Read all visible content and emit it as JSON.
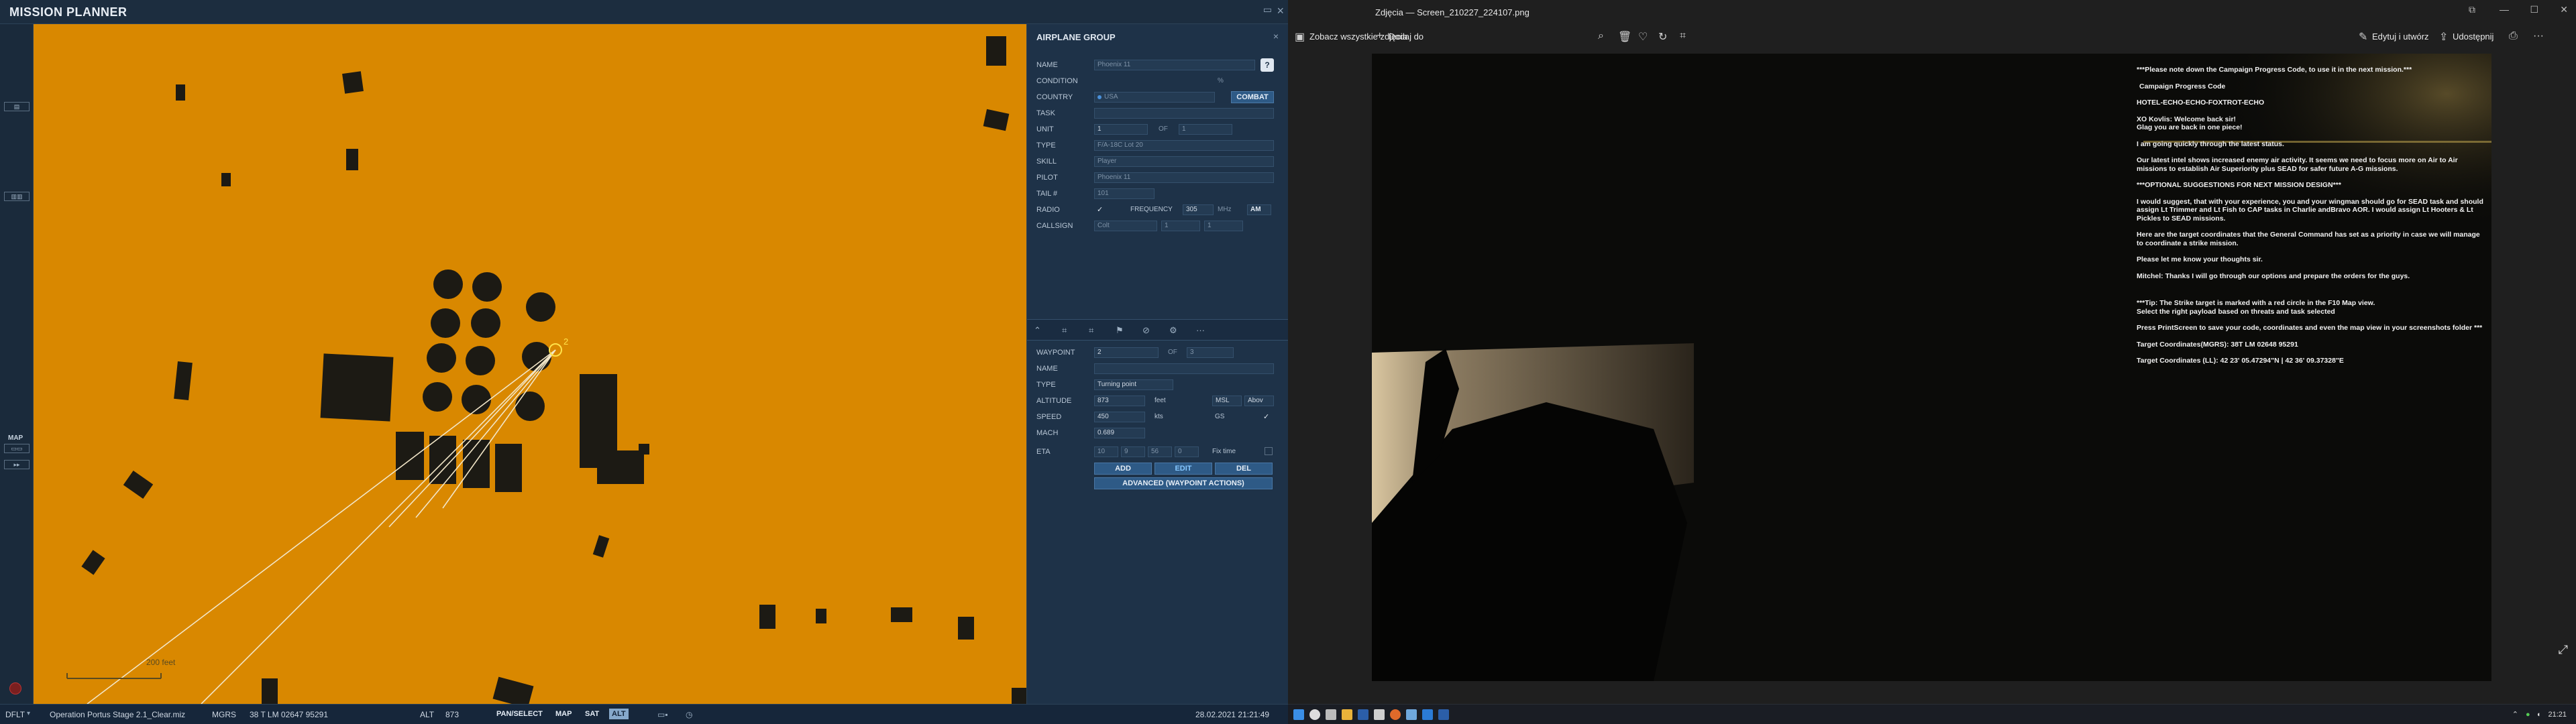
{
  "mission_planner": {
    "title": "MISSION PLANNER",
    "left_toolbar": {
      "map_label": "MAP"
    },
    "map": {
      "waypoint_label": "2",
      "scale_label": "200 feet"
    },
    "panel": {
      "group_title": "AIRPLANE GROUP",
      "help_label": "?",
      "fields": {
        "name_label": "NAME",
        "name_value": "Phoenix 11",
        "condition_label": "CONDITION",
        "condition_value": "%",
        "country_label": "COUNTRY",
        "country_value": "USA",
        "combat_label": "COMBAT",
        "task_label": "TASK",
        "unit_label": "UNIT",
        "unit_value": "1",
        "of_label": "OF",
        "unit_of_value": "1",
        "type_label": "TYPE",
        "type_value": "F/A-18C Lot 20",
        "skill_label": "SKILL",
        "skill_value": "Player",
        "pilot_label": "PILOT",
        "pilot_value": "Phoenix 11",
        "tail_label": "TAIL #",
        "tail_value": "101",
        "radio_label": "RADIO",
        "frequency_label": "FREQUENCY",
        "frequency_value": "305",
        "mhz_label": "MHz",
        "am_label": "AM",
        "callsign_label": "CALLSIGN",
        "callsign_value": "Colt",
        "callsign_n1": "1",
        "callsign_n2": "1"
      },
      "waypoint": {
        "waypoint_label": "WAYPOINT",
        "waypoint_value": "2",
        "of_label": "OF",
        "of_value": "3",
        "name_label": "NAME",
        "type_label": "TYPE",
        "type_value": "Turning point",
        "altitude_label": "ALTITUDE",
        "altitude_value": "873",
        "altitude_unit": "feet",
        "alt_ref": "MSL",
        "alt_ref2": "Abov",
        "speed_label": "SPEED",
        "speed_value": "450",
        "speed_unit": "kts",
        "gs_label": "GS",
        "mach_label": "MACH",
        "mach_value": "0.689",
        "eta_label": "ETA",
        "eta_h": "10",
        "eta_m": "9",
        "eta_s": "56",
        "eta_f": "0",
        "fix_time_label": "Fix time"
      },
      "buttons": {
        "add": "ADD",
        "edit": "EDIT",
        "del": "DEL",
        "advanced": "ADVANCED (WAYPOINT ACTIONS)"
      }
    },
    "status_bar": {
      "profile": "DFLT",
      "mission_file": "Operation Portus Stage 2.1_Clear.miz",
      "coord_system": "MGRS",
      "coords": "38 T LM 02647 95291",
      "alt_label": "ALT",
      "alt_value": "873",
      "pan_select": "PAN/SELECT",
      "map": "MAP",
      "sat": "SAT",
      "alt_btn": "ALT",
      "datetime": "28.02.2021 21:21:49"
    }
  },
  "photos": {
    "window_title": "Zdjęcia — Screen_210227_224107.png",
    "toolbar": {
      "see_all": "Zobacz wszystkie zdjęcia",
      "add_to": "Dodaj do",
      "edit_create": "Edytuj i utwórz",
      "share": "Udostępnij"
    },
    "briefing": [
      "***Please note down the Campaign Progress Code, to use it in the next mission.***",
      "Campaign Progress Code",
      "HOTEL-ECHO-ECHO-FOXTROT-ECHO",
      "XO Kovlis: Welcome back sir!",
      "Glag you are back in one piece!",
      "I am going quickly through the latest status.",
      "Our latest intel shows increased enemy air activity. It seems we need to focus more on Air to Air missions to establish Air Superiority plus SEAD for safer future A-G missions.",
      "***OPTIONAL SUGGESTIONS FOR NEXT MISSION DESIGN***",
      "I would suggest, that with your experience, you and your wingman should go for SEAD task and should assign Lt Trimmer and Lt Fish to CAP tasks in Charlie andBravo AOR. I would assign Lt Hooters & Lt Pickles to SEAD missions.",
      "Here are the target coordinates that the General Command has set as a priority in case we will manage to coordinate a strike mission.",
      "Please let me know your thoughts sir.",
      "Mitchel: Thanks I will go through our options and prepare the orders for the guys.",
      "***Tip: The Strike target is marked with a red circle in the F10 Map view.",
      "Select the right payload based on threats and task selected",
      "Press PrintScreen to save your code, coordinates and even the map view in your screenshots folder ***",
      "Target Coordinates(MGRS): 38T LM 02648 95291",
      "Target Coordinates (LL): 42 23' 05.47294\"N | 42 36' 09.37328\"E"
    ]
  },
  "taskbar": {
    "time": "21:21"
  },
  "colors": {
    "map_bg": "#d98800",
    "panel_bg": "#1e3248",
    "accent": "#86c7ff"
  }
}
